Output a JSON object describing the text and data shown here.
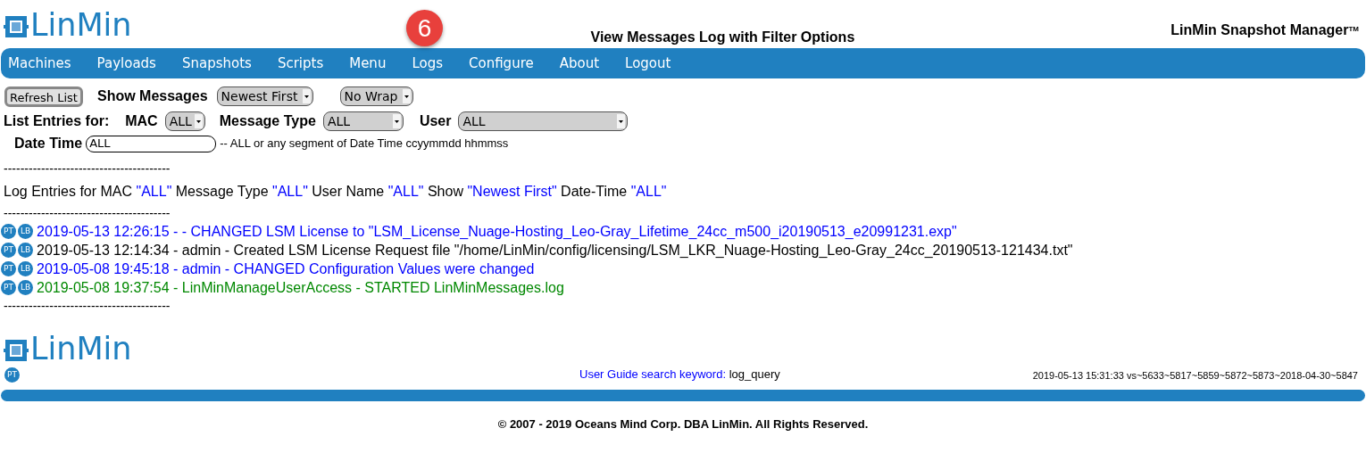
{
  "header": {
    "logo": "LinMin",
    "page_title": "View Messages Log with Filter Options",
    "product": "LinMin Snapshot Manager",
    "trademark": "TM",
    "step_badge": "6"
  },
  "nav": [
    {
      "label": "Machines"
    },
    {
      "label": "Payloads"
    },
    {
      "label": "Snapshots"
    },
    {
      "label": "Scripts"
    },
    {
      "label": "Menu"
    },
    {
      "label": "Logs"
    },
    {
      "label": "Configure"
    },
    {
      "label": "About"
    },
    {
      "label": "Logout"
    }
  ],
  "controls": {
    "refresh_button": "Refresh List",
    "show_messages_label": "Show Messages",
    "order_select": "Newest First",
    "wrap_select": "No Wrap",
    "list_entries_label": "List Entries for:",
    "mac_label": "MAC",
    "mac_select": "ALL",
    "message_type_label": "Message Type",
    "message_type_select": "ALL",
    "user_label": "User",
    "user_select": "ALL",
    "date_time_label": "Date Time",
    "date_time_value": "ALL",
    "date_time_hint": "-- ALL or any segment of Date Time ccyymmdd hhmmss"
  },
  "separator": "----------------------------------------",
  "summary": [
    {
      "text": "Log Entries for MAC",
      "quoted": false
    },
    {
      "text": "\"ALL\"",
      "quoted": true
    },
    {
      "text": "Message Type",
      "quoted": false
    },
    {
      "text": "\"ALL\"",
      "quoted": true
    },
    {
      "text": "User Name",
      "quoted": false
    },
    {
      "text": "\"ALL\"",
      "quoted": true
    },
    {
      "text": "Show",
      "quoted": false
    },
    {
      "text": "\"Newest First\"",
      "quoted": true
    },
    {
      "text": "Date-Time",
      "quoted": false
    },
    {
      "text": "\"ALL\"",
      "quoted": true
    }
  ],
  "log_entries": [
    {
      "pt": "PT",
      "lb": "LB",
      "text": "2019-05-13 12:26:15 - - CHANGED LSM License to \"LSM_License_Nuage-Hosting_Leo-Gray_Lifetime_24cc_m500_i20190513_e20991231.exp\"",
      "color": "#0000ff"
    },
    {
      "pt": "PT",
      "lb": "LB",
      "text": "2019-05-13 12:14:34 - admin - Created LSM License Request file \"/home/LinMin/config/licensing/LSM_LKR_Nuage-Hosting_Leo-Gray_24cc_20190513-121434.txt\"",
      "color": "#000000"
    },
    {
      "pt": "PT",
      "lb": "LB",
      "text": "2019-05-08 19:45:18 - admin - CHANGED Configuration Values were changed",
      "color": "#0000ff"
    },
    {
      "pt": "PT",
      "lb": "LB",
      "text": "2019-05-08 19:37:54 - LinMinManageUserAccess - STARTED LinMinMessages.log",
      "color": "#008800"
    }
  ],
  "footer": {
    "logo": "LinMin",
    "pt": "PT",
    "guide_label": "User Guide search keyword:",
    "guide_keyword": "log_query",
    "version": "2019-05-13 15:31:33 vs~5633~5817~5859~5872~5873~2018-04-30~5847",
    "copyright": "© 2007 - 2019 Oceans Mind Corp. DBA LinMin. All Rights Reserved."
  }
}
